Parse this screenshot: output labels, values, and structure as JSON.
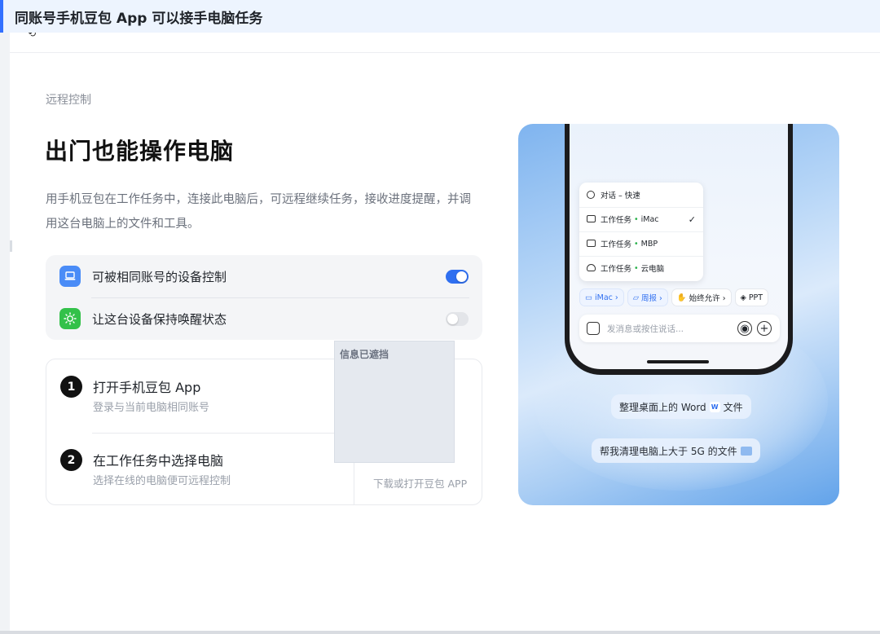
{
  "banner": {
    "title": "同账号手机豆包 App 可以接手电脑任务"
  },
  "page": {
    "section_label": "远程控制",
    "title": "出门也能操作电脑",
    "description": "用手机豆包在工作任务中，连接此电脑后，可远程继续任务，接收进度提醒，并调用这台电脑上的文件和工具。"
  },
  "settings": {
    "items": [
      {
        "label": "可被相同账号的设备控制",
        "icon": "laptop-icon",
        "enabled": true
      },
      {
        "label": "让这台设备保持唤醒状态",
        "icon": "sun-icon",
        "enabled": false
      }
    ]
  },
  "steps": [
    {
      "number": "1",
      "title": "打开手机豆包 App",
      "subtitle": "登录与当前电脑相同账号"
    },
    {
      "number": "2",
      "title": "在工作任务中选择电脑",
      "subtitle": "选择在线的电脑便可远程控制"
    }
  ],
  "qr": {
    "caption": "下载或打开豆包 APP"
  },
  "redaction": {
    "label": "信息已遮挡"
  },
  "phone": {
    "menu": [
      {
        "icon": "chat-icon",
        "prefix": "对话 – 快速",
        "device": "",
        "checked": false
      },
      {
        "icon": "laptop-icon",
        "prefix": "工作任务",
        "device": "iMac",
        "checked": true
      },
      {
        "icon": "laptop-icon",
        "prefix": "工作任务",
        "device": "MBP",
        "checked": false
      },
      {
        "icon": "cloud-icon",
        "prefix": "工作任务",
        "device": "云电脑",
        "checked": false
      }
    ],
    "check_glyph": "✓",
    "dot": "•",
    "chips": [
      {
        "label": "iMac ›",
        "icon": "laptop-icon",
        "accent": true
      },
      {
        "label": "周报 ›",
        "icon": "folder-icon",
        "accent": true
      },
      {
        "label": "始终允许 ›",
        "icon": "hand-icon",
        "accent": false
      },
      {
        "label": "PPT",
        "icon": "layers-icon",
        "accent": false
      }
    ],
    "input_placeholder": "发消息或按住说话...",
    "plus_glyph": "+",
    "voice_glyph": "◉"
  },
  "bubbles": [
    {
      "before": "整理桌面上的 Word",
      "tag": "W",
      "after": "文件"
    },
    {
      "before": "帮我清理电脑上大于 5G 的文件",
      "tag": "",
      "after": ""
    }
  ],
  "colors": {
    "accent": "#2f6ff0",
    "toggle_on": "#2f6ff0",
    "green_icon": "#33c14a",
    "blue_icon": "#4a8cf7"
  }
}
